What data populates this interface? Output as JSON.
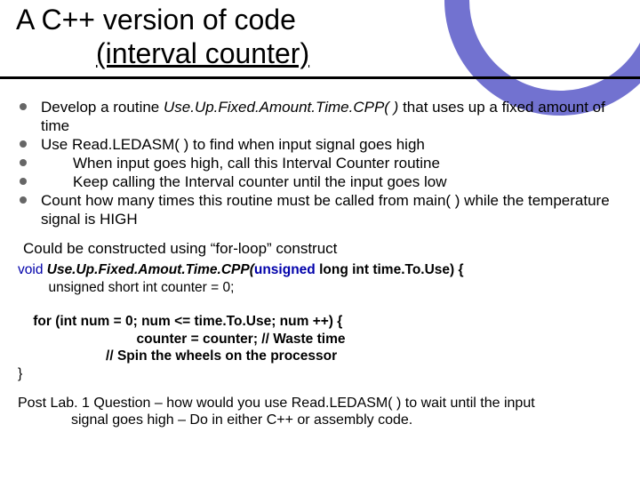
{
  "title_line1": "A C++ version of code",
  "title_line2": "(interval counter)",
  "bullets": [
    {
      "pre": "Develop a routine ",
      "em": "Use.Up.Fixed.Amount.Time.CPP( )",
      "post": " that uses up a fixed amount of time"
    },
    {
      "pre": "Use Read.LEDASM( ) to find when input signal goes high",
      "em": "",
      "post": ""
    },
    {
      "pre": "",
      "em": "",
      "post": "When input goes high, call this Interval Counter routine",
      "indent": true
    },
    {
      "pre": "",
      "em": "",
      "post": "Keep calling the Interval counter until the input goes low",
      "indent": true
    },
    {
      "pre": "Count how many times this routine must be called from main( ) while the temperature signal is HIGH",
      "em": "",
      "post": ""
    }
  ],
  "para1": "Could be constructed using “for-loop” construct",
  "code": {
    "l1a": "void ",
    "l1b": "Use.Up.Fixed.Amout.Time.CPP(",
    "l1c": "unsigned",
    "l1d": " long int time.To.Use) {",
    "l2": "        unsigned short int counter = 0;",
    "l3": "",
    "l4": "    for (int num = 0; num <= time.To.Use; num ++) {",
    "l5": "                               counter = counter; // Waste time",
    "l6": "                       // Spin the wheels on the processor",
    "l7": "}"
  },
  "postlab": {
    "line1": "Post Lab. 1 Question – how would you use Read.LEDASM( ) to wait until the input",
    "line2": "signal goes high – Do in either C++ or assembly code."
  }
}
